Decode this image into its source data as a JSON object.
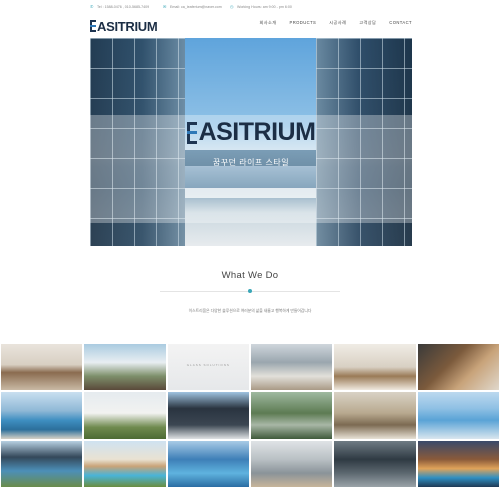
{
  "topbar": {
    "phone": "Tel : 1588-0476 , 010-5685-7409",
    "email": "Email: ca_leaferium@naver.com",
    "hours": "Working Hours: am 9:00 - pm 6:00"
  },
  "brand": {
    "name": "ASITRIUM",
    "colors": {
      "navy": "#1c2e45",
      "accent_blue": "#2e78b7",
      "teal": "#3aa7b8"
    }
  },
  "nav": {
    "items": [
      "회사소개",
      "PRODUCTS",
      "시공사례",
      "고객상담",
      "CONTACT"
    ]
  },
  "hero": {
    "logo_text": "ASITRIUM",
    "tagline": "꿈꾸던 라이프 스타일"
  },
  "section": {
    "title": "What We Do",
    "description": "이스트리움은 다양한 솔루션으로 여러분의 삶을 새롭고 행복하게 만들어갑니다"
  },
  "gallery": {
    "caption": "GLASS SOLUTIONS",
    "items": [
      {
        "icon": "modern-living-room"
      },
      {
        "icon": "terrace-dining"
      },
      {
        "icon": "white-interior"
      },
      {
        "icon": "glass-roof-house"
      },
      {
        "icon": "sunroom-lounge"
      },
      {
        "icon": "glass-canopy"
      },
      {
        "icon": "ocean-pool"
      },
      {
        "icon": "white-conservatory"
      },
      {
        "icon": "dark-sunroom"
      },
      {
        "icon": "garden-glasshouse"
      },
      {
        "icon": "interior-hall"
      },
      {
        "icon": "dome-pool-cover"
      },
      {
        "icon": "pool-enclosure"
      },
      {
        "icon": "villa-pool"
      },
      {
        "icon": "blue-pool-cover"
      },
      {
        "icon": "patio-pool-cover"
      },
      {
        "icon": "dark-pool-cover"
      },
      {
        "icon": "night-house-pool"
      }
    ]
  }
}
